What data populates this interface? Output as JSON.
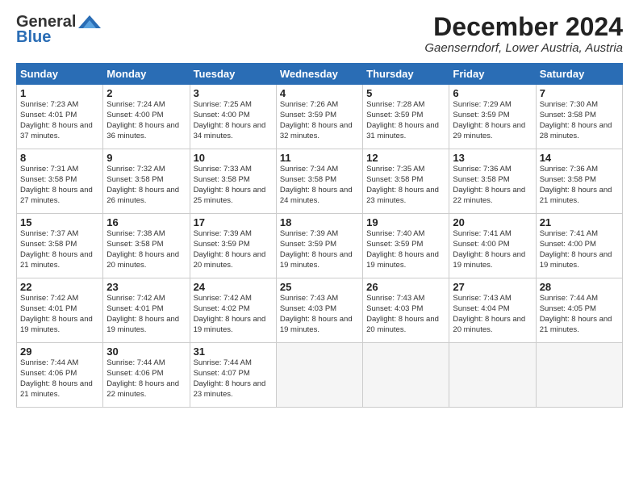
{
  "logo": {
    "general": "General",
    "blue": "Blue"
  },
  "title": "December 2024",
  "location": "Gaenserndorf, Lower Austria, Austria",
  "days_of_week": [
    "Sunday",
    "Monday",
    "Tuesday",
    "Wednesday",
    "Thursday",
    "Friday",
    "Saturday"
  ],
  "weeks": [
    [
      {
        "day": 1,
        "sunrise": "7:23 AM",
        "sunset": "4:01 PM",
        "daylight": "8 hours and 37 minutes."
      },
      {
        "day": 2,
        "sunrise": "7:24 AM",
        "sunset": "4:00 PM",
        "daylight": "8 hours and 36 minutes."
      },
      {
        "day": 3,
        "sunrise": "7:25 AM",
        "sunset": "4:00 PM",
        "daylight": "8 hours and 34 minutes."
      },
      {
        "day": 4,
        "sunrise": "7:26 AM",
        "sunset": "3:59 PM",
        "daylight": "8 hours and 32 minutes."
      },
      {
        "day": 5,
        "sunrise": "7:28 AM",
        "sunset": "3:59 PM",
        "daylight": "8 hours and 31 minutes."
      },
      {
        "day": 6,
        "sunrise": "7:29 AM",
        "sunset": "3:59 PM",
        "daylight": "8 hours and 29 minutes."
      },
      {
        "day": 7,
        "sunrise": "7:30 AM",
        "sunset": "3:58 PM",
        "daylight": "8 hours and 28 minutes."
      }
    ],
    [
      {
        "day": 8,
        "sunrise": "7:31 AM",
        "sunset": "3:58 PM",
        "daylight": "8 hours and 27 minutes."
      },
      {
        "day": 9,
        "sunrise": "7:32 AM",
        "sunset": "3:58 PM",
        "daylight": "8 hours and 26 minutes."
      },
      {
        "day": 10,
        "sunrise": "7:33 AM",
        "sunset": "3:58 PM",
        "daylight": "8 hours and 25 minutes."
      },
      {
        "day": 11,
        "sunrise": "7:34 AM",
        "sunset": "3:58 PM",
        "daylight": "8 hours and 24 minutes."
      },
      {
        "day": 12,
        "sunrise": "7:35 AM",
        "sunset": "3:58 PM",
        "daylight": "8 hours and 23 minutes."
      },
      {
        "day": 13,
        "sunrise": "7:36 AM",
        "sunset": "3:58 PM",
        "daylight": "8 hours and 22 minutes."
      },
      {
        "day": 14,
        "sunrise": "7:36 AM",
        "sunset": "3:58 PM",
        "daylight": "8 hours and 21 minutes."
      }
    ],
    [
      {
        "day": 15,
        "sunrise": "7:37 AM",
        "sunset": "3:58 PM",
        "daylight": "8 hours and 21 minutes."
      },
      {
        "day": 16,
        "sunrise": "7:38 AM",
        "sunset": "3:58 PM",
        "daylight": "8 hours and 20 minutes."
      },
      {
        "day": 17,
        "sunrise": "7:39 AM",
        "sunset": "3:59 PM",
        "daylight": "8 hours and 20 minutes."
      },
      {
        "day": 18,
        "sunrise": "7:39 AM",
        "sunset": "3:59 PM",
        "daylight": "8 hours and 19 minutes."
      },
      {
        "day": 19,
        "sunrise": "7:40 AM",
        "sunset": "3:59 PM",
        "daylight": "8 hours and 19 minutes."
      },
      {
        "day": 20,
        "sunrise": "7:41 AM",
        "sunset": "4:00 PM",
        "daylight": "8 hours and 19 minutes."
      },
      {
        "day": 21,
        "sunrise": "7:41 AM",
        "sunset": "4:00 PM",
        "daylight": "8 hours and 19 minutes."
      }
    ],
    [
      {
        "day": 22,
        "sunrise": "7:42 AM",
        "sunset": "4:01 PM",
        "daylight": "8 hours and 19 minutes."
      },
      {
        "day": 23,
        "sunrise": "7:42 AM",
        "sunset": "4:01 PM",
        "daylight": "8 hours and 19 minutes."
      },
      {
        "day": 24,
        "sunrise": "7:42 AM",
        "sunset": "4:02 PM",
        "daylight": "8 hours and 19 minutes."
      },
      {
        "day": 25,
        "sunrise": "7:43 AM",
        "sunset": "4:03 PM",
        "daylight": "8 hours and 19 minutes."
      },
      {
        "day": 26,
        "sunrise": "7:43 AM",
        "sunset": "4:03 PM",
        "daylight": "8 hours and 20 minutes."
      },
      {
        "day": 27,
        "sunrise": "7:43 AM",
        "sunset": "4:04 PM",
        "daylight": "8 hours and 20 minutes."
      },
      {
        "day": 28,
        "sunrise": "7:44 AM",
        "sunset": "4:05 PM",
        "daylight": "8 hours and 21 minutes."
      }
    ],
    [
      {
        "day": 29,
        "sunrise": "7:44 AM",
        "sunset": "4:06 PM",
        "daylight": "8 hours and 21 minutes."
      },
      {
        "day": 30,
        "sunrise": "7:44 AM",
        "sunset": "4:06 PM",
        "daylight": "8 hours and 22 minutes."
      },
      {
        "day": 31,
        "sunrise": "7:44 AM",
        "sunset": "4:07 PM",
        "daylight": "8 hours and 23 minutes."
      },
      null,
      null,
      null,
      null
    ]
  ]
}
